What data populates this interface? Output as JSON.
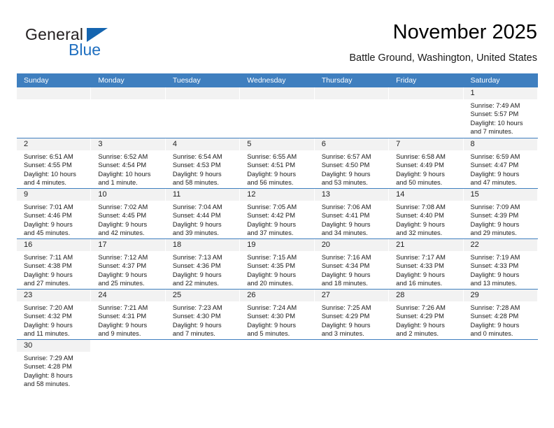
{
  "brand": {
    "word1": "General",
    "word2": "Blue",
    "icon": "triangle-logo"
  },
  "header": {
    "title": "November 2025",
    "subtitle": "Battle Ground, Washington, United States"
  },
  "weekdays": [
    "Sunday",
    "Monday",
    "Tuesday",
    "Wednesday",
    "Thursday",
    "Friday",
    "Saturday"
  ],
  "colors": {
    "header_bar": "#3f7fbf",
    "day_band": "#f2f2f2",
    "brand_blue": "#1565b0"
  },
  "weeks": [
    [
      {
        "empty": true
      },
      {
        "empty": true
      },
      {
        "empty": true
      },
      {
        "empty": true
      },
      {
        "empty": true
      },
      {
        "empty": true
      },
      {
        "day": "1",
        "sunrise": "Sunrise: 7:49 AM",
        "sunset": "Sunset: 5:57 PM",
        "daylight1": "Daylight: 10 hours",
        "daylight2": "and 7 minutes."
      }
    ],
    [
      {
        "day": "2",
        "sunrise": "Sunrise: 6:51 AM",
        "sunset": "Sunset: 4:55 PM",
        "daylight1": "Daylight: 10 hours",
        "daylight2": "and 4 minutes."
      },
      {
        "day": "3",
        "sunrise": "Sunrise: 6:52 AM",
        "sunset": "Sunset: 4:54 PM",
        "daylight1": "Daylight: 10 hours",
        "daylight2": "and 1 minute."
      },
      {
        "day": "4",
        "sunrise": "Sunrise: 6:54 AM",
        "sunset": "Sunset: 4:53 PM",
        "daylight1": "Daylight: 9 hours",
        "daylight2": "and 58 minutes."
      },
      {
        "day": "5",
        "sunrise": "Sunrise: 6:55 AM",
        "sunset": "Sunset: 4:51 PM",
        "daylight1": "Daylight: 9 hours",
        "daylight2": "and 56 minutes."
      },
      {
        "day": "6",
        "sunrise": "Sunrise: 6:57 AM",
        "sunset": "Sunset: 4:50 PM",
        "daylight1": "Daylight: 9 hours",
        "daylight2": "and 53 minutes."
      },
      {
        "day": "7",
        "sunrise": "Sunrise: 6:58 AM",
        "sunset": "Sunset: 4:49 PM",
        "daylight1": "Daylight: 9 hours",
        "daylight2": "and 50 minutes."
      },
      {
        "day": "8",
        "sunrise": "Sunrise: 6:59 AM",
        "sunset": "Sunset: 4:47 PM",
        "daylight1": "Daylight: 9 hours",
        "daylight2": "and 47 minutes."
      }
    ],
    [
      {
        "day": "9",
        "sunrise": "Sunrise: 7:01 AM",
        "sunset": "Sunset: 4:46 PM",
        "daylight1": "Daylight: 9 hours",
        "daylight2": "and 45 minutes."
      },
      {
        "day": "10",
        "sunrise": "Sunrise: 7:02 AM",
        "sunset": "Sunset: 4:45 PM",
        "daylight1": "Daylight: 9 hours",
        "daylight2": "and 42 minutes."
      },
      {
        "day": "11",
        "sunrise": "Sunrise: 7:04 AM",
        "sunset": "Sunset: 4:44 PM",
        "daylight1": "Daylight: 9 hours",
        "daylight2": "and 39 minutes."
      },
      {
        "day": "12",
        "sunrise": "Sunrise: 7:05 AM",
        "sunset": "Sunset: 4:42 PM",
        "daylight1": "Daylight: 9 hours",
        "daylight2": "and 37 minutes."
      },
      {
        "day": "13",
        "sunrise": "Sunrise: 7:06 AM",
        "sunset": "Sunset: 4:41 PM",
        "daylight1": "Daylight: 9 hours",
        "daylight2": "and 34 minutes."
      },
      {
        "day": "14",
        "sunrise": "Sunrise: 7:08 AM",
        "sunset": "Sunset: 4:40 PM",
        "daylight1": "Daylight: 9 hours",
        "daylight2": "and 32 minutes."
      },
      {
        "day": "15",
        "sunrise": "Sunrise: 7:09 AM",
        "sunset": "Sunset: 4:39 PM",
        "daylight1": "Daylight: 9 hours",
        "daylight2": "and 29 minutes."
      }
    ],
    [
      {
        "day": "16",
        "sunrise": "Sunrise: 7:11 AM",
        "sunset": "Sunset: 4:38 PM",
        "daylight1": "Daylight: 9 hours",
        "daylight2": "and 27 minutes."
      },
      {
        "day": "17",
        "sunrise": "Sunrise: 7:12 AM",
        "sunset": "Sunset: 4:37 PM",
        "daylight1": "Daylight: 9 hours",
        "daylight2": "and 25 minutes."
      },
      {
        "day": "18",
        "sunrise": "Sunrise: 7:13 AM",
        "sunset": "Sunset: 4:36 PM",
        "daylight1": "Daylight: 9 hours",
        "daylight2": "and 22 minutes."
      },
      {
        "day": "19",
        "sunrise": "Sunrise: 7:15 AM",
        "sunset": "Sunset: 4:35 PM",
        "daylight1": "Daylight: 9 hours",
        "daylight2": "and 20 minutes."
      },
      {
        "day": "20",
        "sunrise": "Sunrise: 7:16 AM",
        "sunset": "Sunset: 4:34 PM",
        "daylight1": "Daylight: 9 hours",
        "daylight2": "and 18 minutes."
      },
      {
        "day": "21",
        "sunrise": "Sunrise: 7:17 AM",
        "sunset": "Sunset: 4:33 PM",
        "daylight1": "Daylight: 9 hours",
        "daylight2": "and 16 minutes."
      },
      {
        "day": "22",
        "sunrise": "Sunrise: 7:19 AM",
        "sunset": "Sunset: 4:33 PM",
        "daylight1": "Daylight: 9 hours",
        "daylight2": "and 13 minutes."
      }
    ],
    [
      {
        "day": "23",
        "sunrise": "Sunrise: 7:20 AM",
        "sunset": "Sunset: 4:32 PM",
        "daylight1": "Daylight: 9 hours",
        "daylight2": "and 11 minutes."
      },
      {
        "day": "24",
        "sunrise": "Sunrise: 7:21 AM",
        "sunset": "Sunset: 4:31 PM",
        "daylight1": "Daylight: 9 hours",
        "daylight2": "and 9 minutes."
      },
      {
        "day": "25",
        "sunrise": "Sunrise: 7:23 AM",
        "sunset": "Sunset: 4:30 PM",
        "daylight1": "Daylight: 9 hours",
        "daylight2": "and 7 minutes."
      },
      {
        "day": "26",
        "sunrise": "Sunrise: 7:24 AM",
        "sunset": "Sunset: 4:30 PM",
        "daylight1": "Daylight: 9 hours",
        "daylight2": "and 5 minutes."
      },
      {
        "day": "27",
        "sunrise": "Sunrise: 7:25 AM",
        "sunset": "Sunset: 4:29 PM",
        "daylight1": "Daylight: 9 hours",
        "daylight2": "and 3 minutes."
      },
      {
        "day": "28",
        "sunrise": "Sunrise: 7:26 AM",
        "sunset": "Sunset: 4:29 PM",
        "daylight1": "Daylight: 9 hours",
        "daylight2": "and 2 minutes."
      },
      {
        "day": "29",
        "sunrise": "Sunrise: 7:28 AM",
        "sunset": "Sunset: 4:28 PM",
        "daylight1": "Daylight: 9 hours",
        "daylight2": "and 0 minutes."
      }
    ],
    [
      {
        "day": "30",
        "sunrise": "Sunrise: 7:29 AM",
        "sunset": "Sunset: 4:28 PM",
        "daylight1": "Daylight: 8 hours",
        "daylight2": "and 58 minutes."
      },
      {
        "blank": true
      },
      {
        "blank": true
      },
      {
        "blank": true
      },
      {
        "blank": true
      },
      {
        "blank": true
      },
      {
        "blank": true
      }
    ]
  ]
}
